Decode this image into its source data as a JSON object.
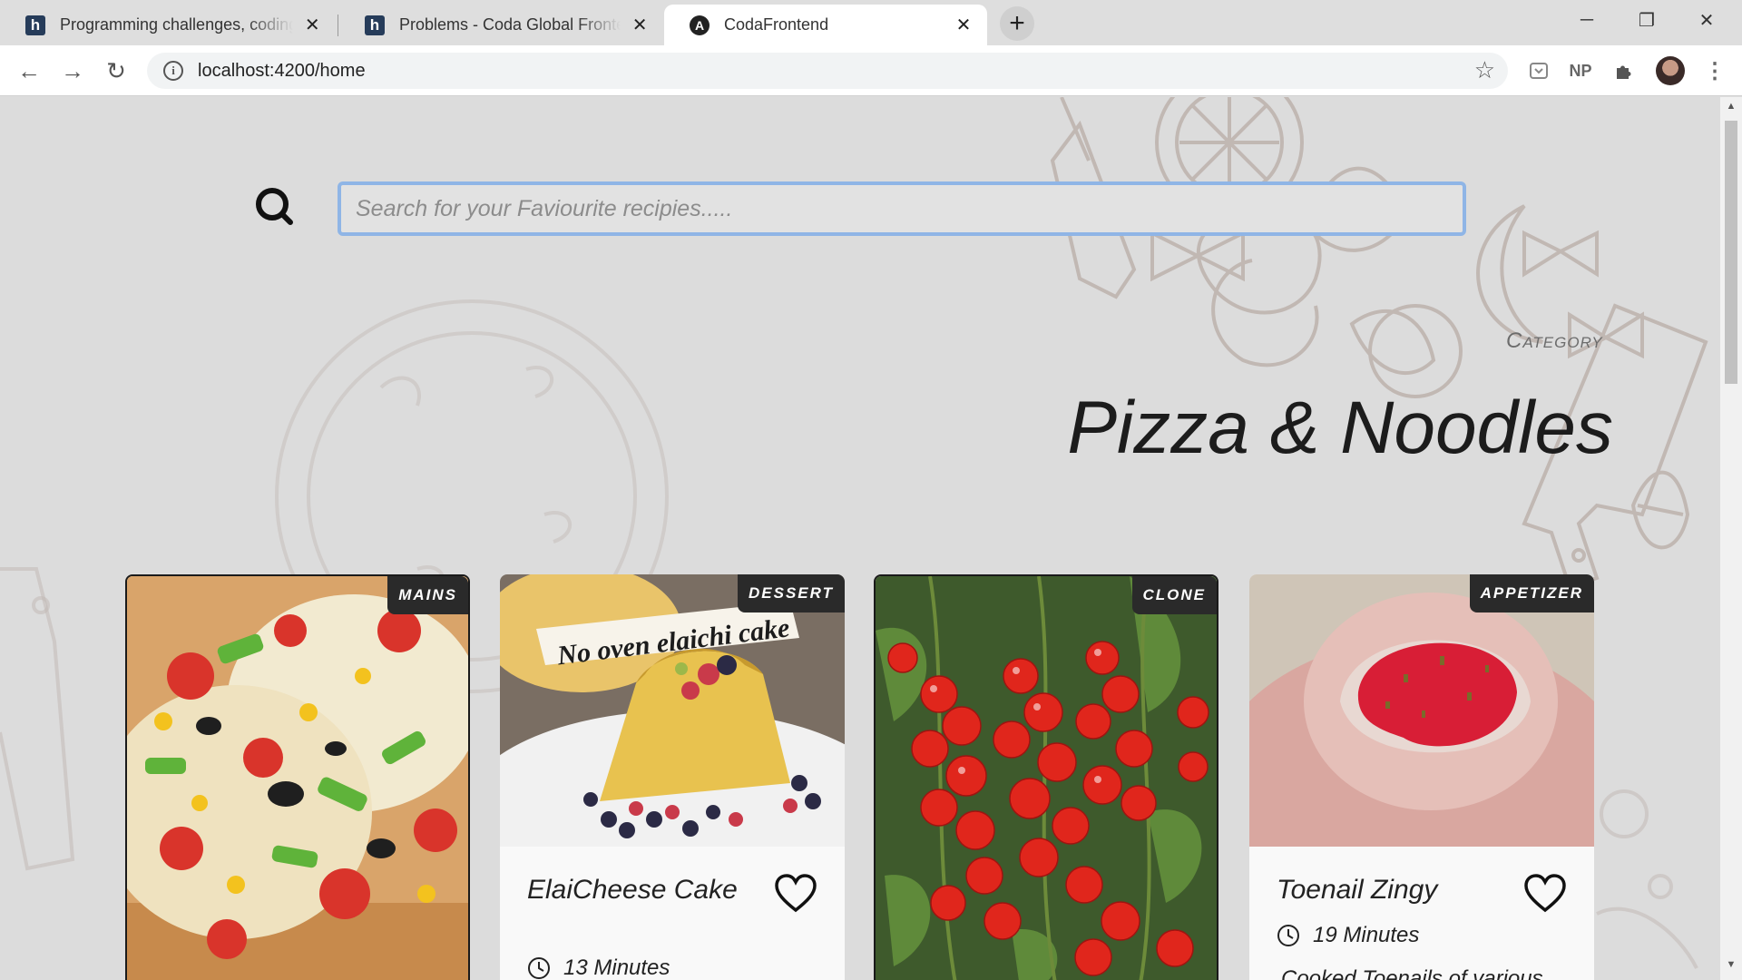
{
  "browser": {
    "tabs": [
      {
        "title": "Programming challenges, coding",
        "favicon": "h"
      },
      {
        "title": "Problems - Coda Global Frontend",
        "favicon": "h"
      },
      {
        "title": "CodaFrontend",
        "favicon": "A"
      }
    ],
    "url": "localhost:4200/home",
    "extensions": {
      "np_label": "NP"
    }
  },
  "search": {
    "placeholder": "Search for your Faviourite recipies....."
  },
  "category": {
    "label": "Category",
    "title": "Pizza & Noodles"
  },
  "cards": [
    {
      "badge": "MAINS",
      "name": "",
      "duration": "",
      "description": ""
    },
    {
      "badge": "DESSERT",
      "name": "ElaiCheese Cake",
      "duration": "13 Minutes",
      "description": "",
      "photo_caption": "No oven elaichi cake"
    },
    {
      "badge": "CLONE",
      "name": "",
      "duration": "",
      "description": ""
    },
    {
      "badge": "APPETIZER",
      "name": "Toenail Zingy",
      "duration": "19 Minutes",
      "description": "Cooked Toenails of various"
    }
  ],
  "colors": {
    "page_bg": "#dcdcdc",
    "badge_bg": "#2a2a2a",
    "search_focus": "#8fb5e6",
    "title_text": "#1c1c1c"
  }
}
